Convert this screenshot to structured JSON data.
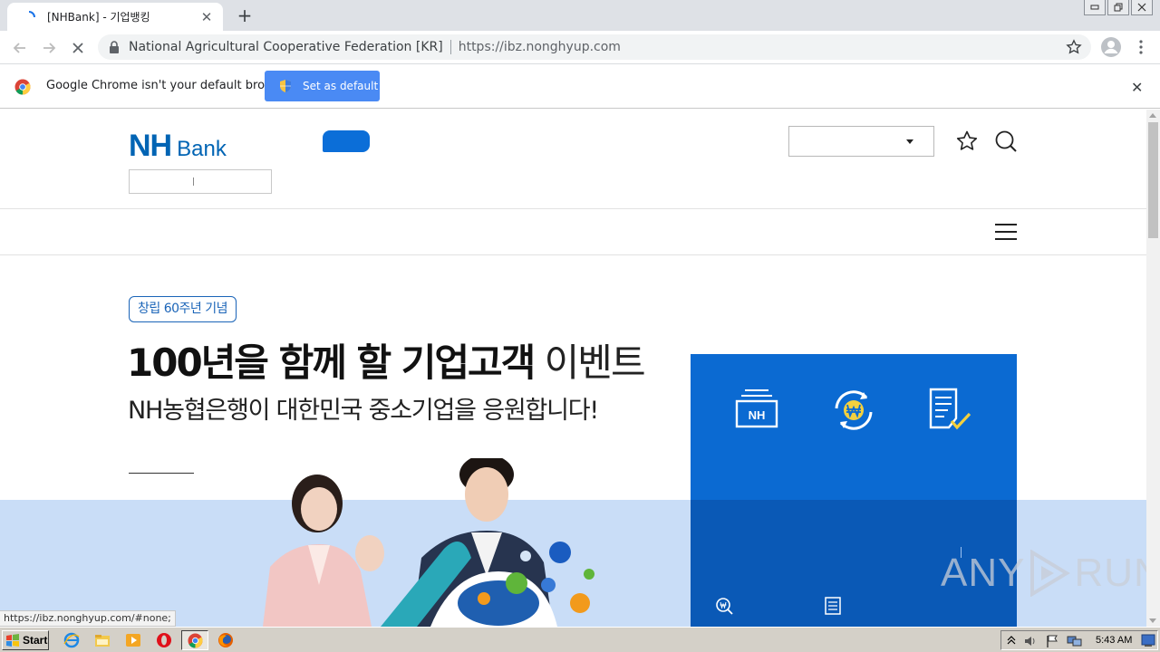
{
  "browser": {
    "tab_title": "[NHBank] - 기업뱅킹",
    "tab_close": "✕",
    "new_tab": "+",
    "site_identity": "National Agricultural Cooperative Federation [KR]",
    "url": "https://ibz.nonghyup.com",
    "infobar": {
      "message": "Google Chrome isn't your default browser",
      "button": "Set as default",
      "close": "✕"
    }
  },
  "page": {
    "logo_nh": "NH",
    "logo_bank": "Bank",
    "badge": "창립 60주년 기념",
    "headline_bold": "100년을 함께 할 기업고객",
    "headline_light": "이벤트",
    "subline": "NH농협은행이 대한민국 중소기업을 응원합니다!",
    "quick_icon_nh_label": "NH",
    "status_url": "https://ibz.nonghyup.com/#none;"
  },
  "watermark": {
    "left": "ANY",
    "right": "RUN"
  },
  "taskbar": {
    "start_label": "Start",
    "clock": "5:43 AM"
  },
  "colors": {
    "nh_blue": "#0064b4",
    "panel_blue": "#0b6ad2",
    "band_blue": "#c9ddf7",
    "chrome_button": "#4a8af4"
  }
}
